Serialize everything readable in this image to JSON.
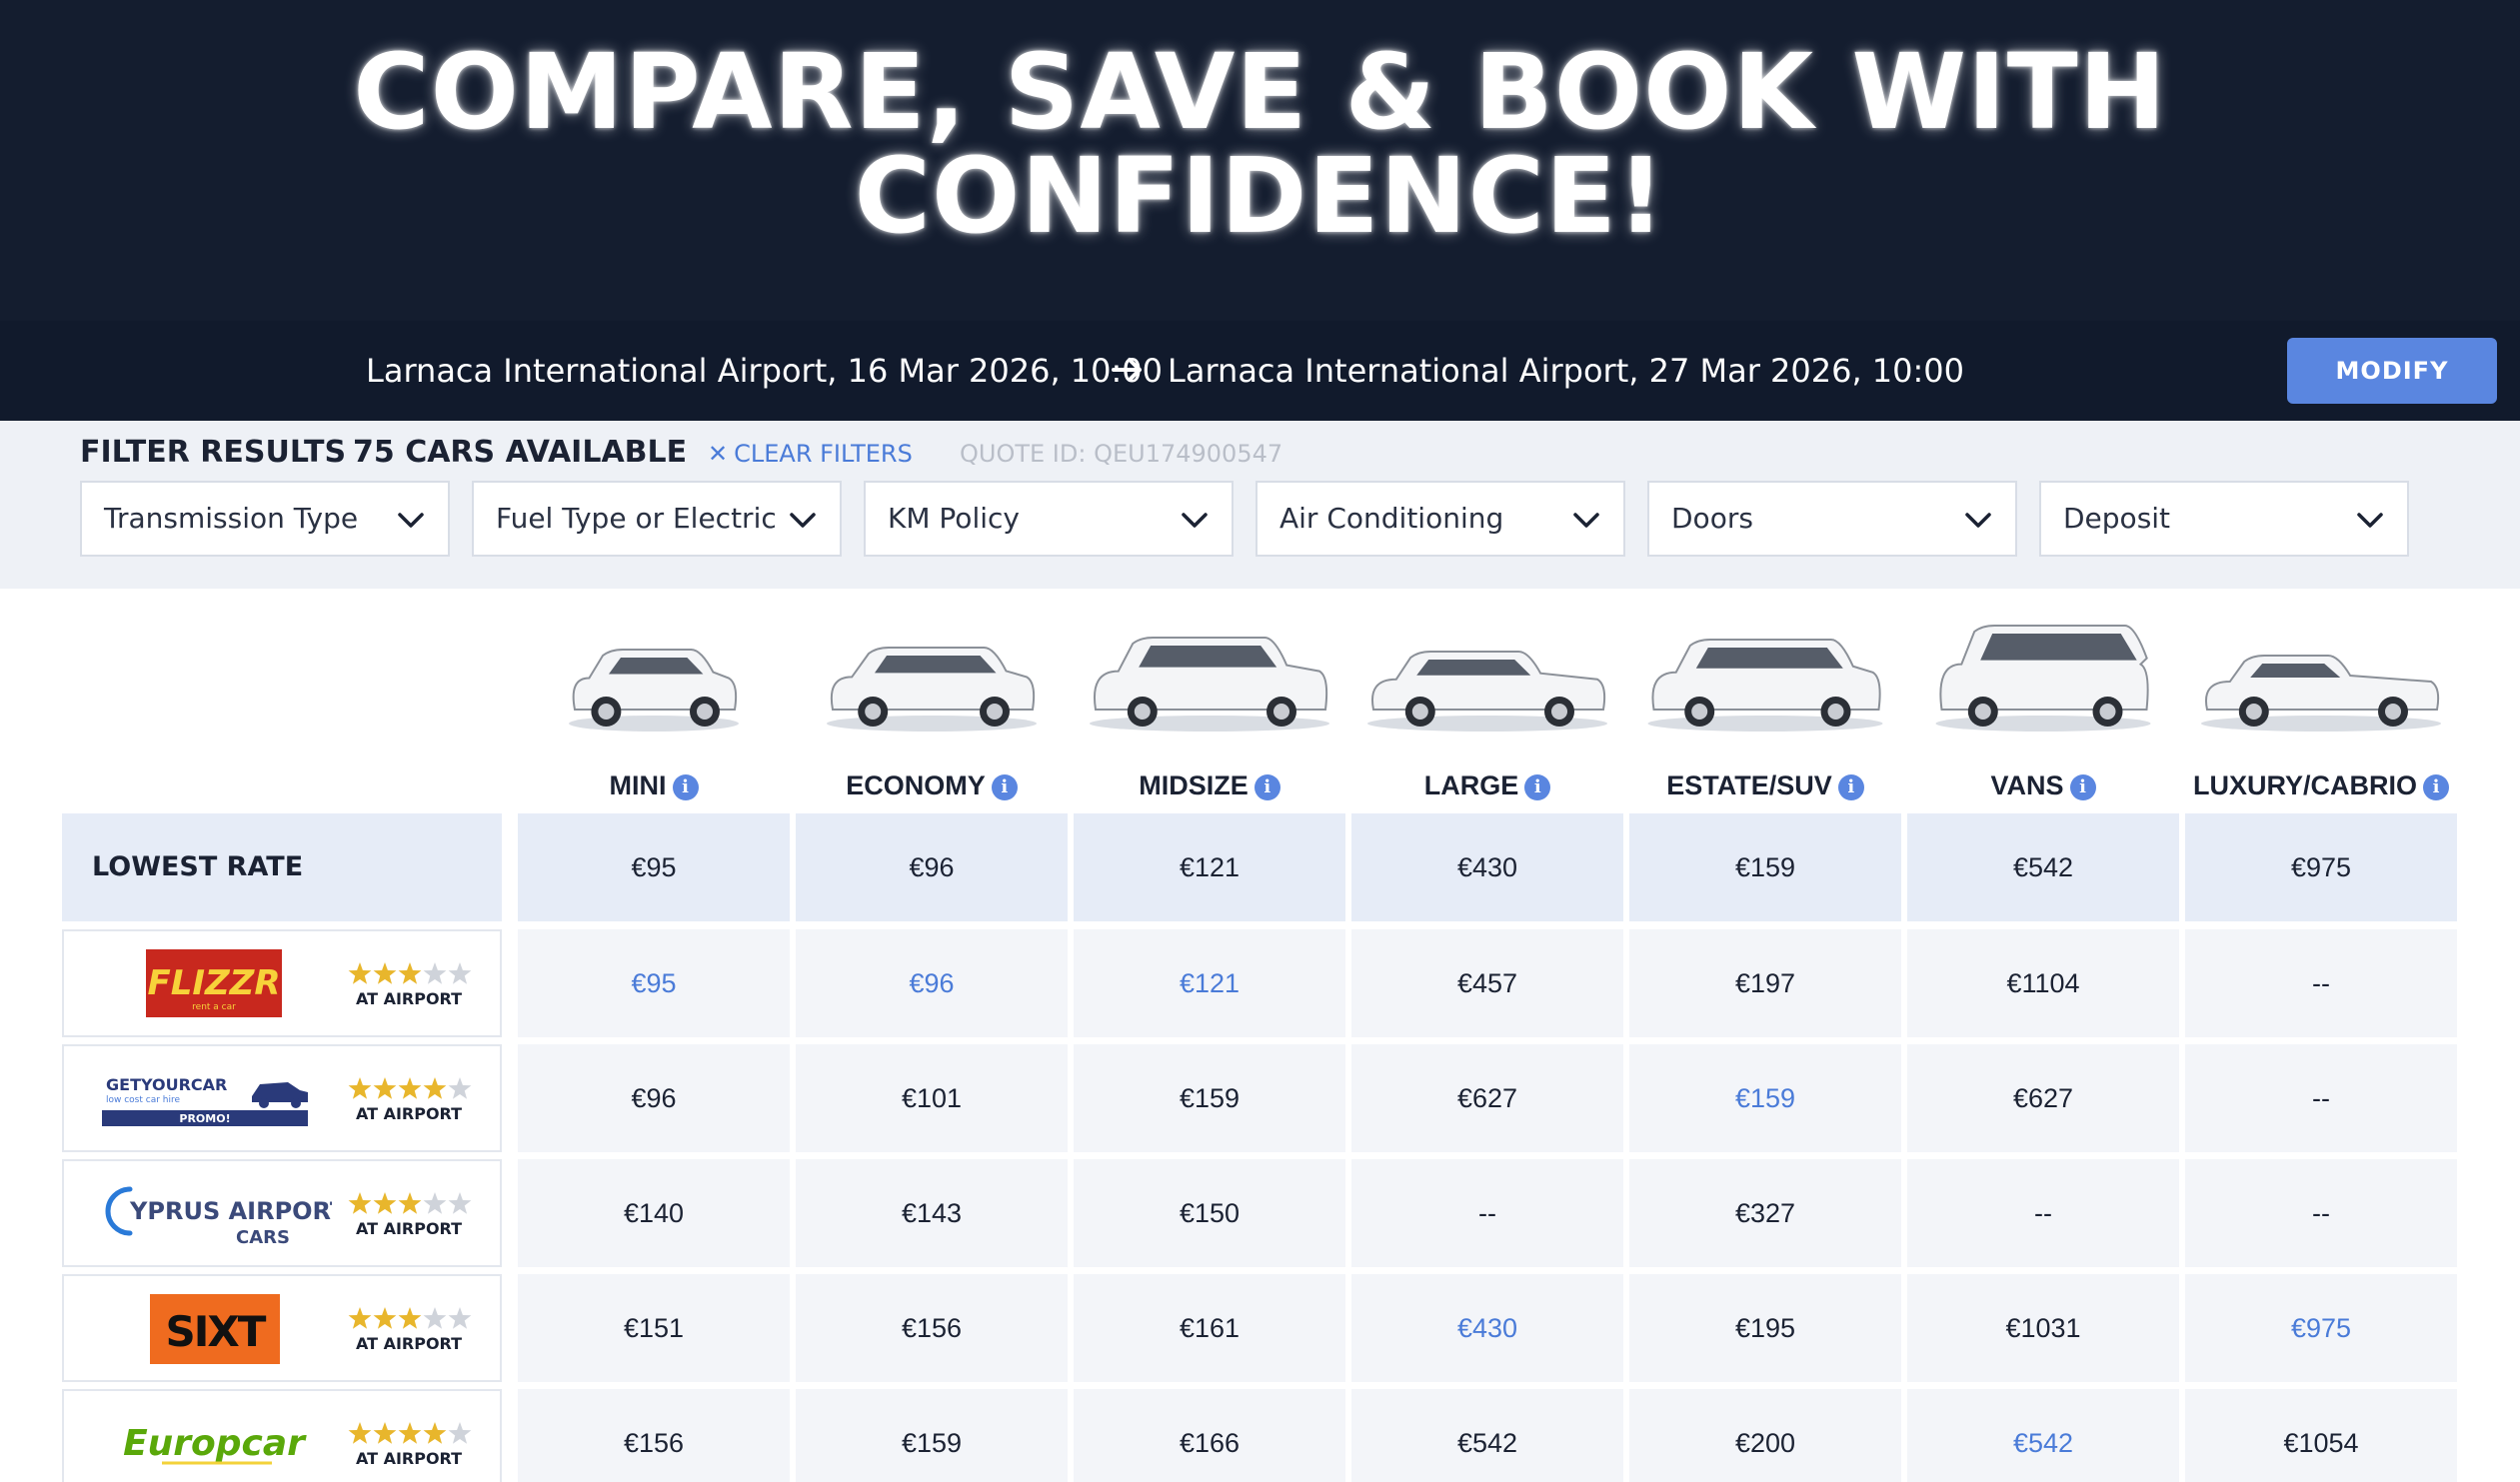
{
  "hero": {
    "title_line1": "COMPARE, SAVE & BOOK WITH",
    "title_line2": "CONFIDENCE!"
  },
  "trip": {
    "pickup": "Larnaca International Airport, 16 Mar 2026, 10:00",
    "arrow_icon": "arrow-right-icon",
    "dropoff": "Larnaca International Airport, 27 Mar 2026, 10:00",
    "modify_label": "MODIFY"
  },
  "filters": {
    "title": "FILTER RESULTS",
    "count": "75 CARS AVAILABLE",
    "clear_label": "CLEAR FILTERS",
    "quote_id": "QUOTE ID: QEU174900547",
    "dropdowns": [
      {
        "label": "Transmission Type"
      },
      {
        "label": "Fuel Type or Electric"
      },
      {
        "label": "KM Policy"
      },
      {
        "label": "Air Conditioning"
      },
      {
        "label": "Doors"
      },
      {
        "label": "Deposit"
      }
    ]
  },
  "table": {
    "categories": [
      "MINI",
      "ECONOMY",
      "MIDSIZE",
      "LARGE",
      "ESTATE/SUV",
      "VANS",
      "LUXURY/CABRIO"
    ],
    "lowest_label": "LOWEST RATE",
    "lowest": [
      "€95",
      "€96",
      "€121",
      "€430",
      "€159",
      "€542",
      "€975"
    ],
    "suppliers": [
      {
        "name": "Flizzr",
        "logo_text": "FLIZZR",
        "logo_sub": "rent a car",
        "rating": 3,
        "location": "AT AIRPORT",
        "prices": [
          "€95",
          "€96",
          "€121",
          "€457",
          "€197",
          "€1104",
          "--"
        ],
        "best": [
          true,
          true,
          true,
          false,
          false,
          false,
          false
        ]
      },
      {
        "name": "GetYourCar",
        "logo_text": "GETYOURCAR",
        "logo_sub": "low cost car hire",
        "logo_badge": "PROMO!",
        "rating": 4,
        "location": "AT AIRPORT",
        "prices": [
          "€96",
          "€101",
          "€159",
          "€627",
          "€159",
          "€627",
          "--"
        ],
        "best": [
          false,
          false,
          false,
          false,
          true,
          false,
          false
        ]
      },
      {
        "name": "Cyprus Airport Cars",
        "logo_text": "YPRUS AIRPORT",
        "logo_sub": "CARS",
        "rating": 3,
        "location": "AT AIRPORT",
        "prices": [
          "€140",
          "€143",
          "€150",
          "--",
          "€327",
          "--",
          "--"
        ],
        "best": [
          false,
          false,
          false,
          false,
          false,
          false,
          false
        ]
      },
      {
        "name": "Sixt",
        "logo_text": "SIXT",
        "rating": 3,
        "location": "AT AIRPORT",
        "prices": [
          "€151",
          "€156",
          "€161",
          "€430",
          "€195",
          "€1031",
          "€975"
        ],
        "best": [
          false,
          false,
          false,
          true,
          false,
          false,
          true
        ]
      },
      {
        "name": "Europcar",
        "logo_text": "Europcar",
        "rating": 4,
        "location": "AT AIRPORT",
        "prices": [
          "€156",
          "€159",
          "€166",
          "€542",
          "€200",
          "€542",
          "€1054"
        ],
        "best": [
          false,
          false,
          false,
          false,
          false,
          true,
          false
        ]
      }
    ]
  },
  "colors": {
    "hero_bg": "#141d2f",
    "accent": "#5a86e0",
    "link": "#4a7bd8",
    "star": "#e8b62c",
    "flizzr_red": "#c8281e",
    "sixt_orange": "#ef6b1f",
    "europcar_green": "#5aa80a"
  }
}
